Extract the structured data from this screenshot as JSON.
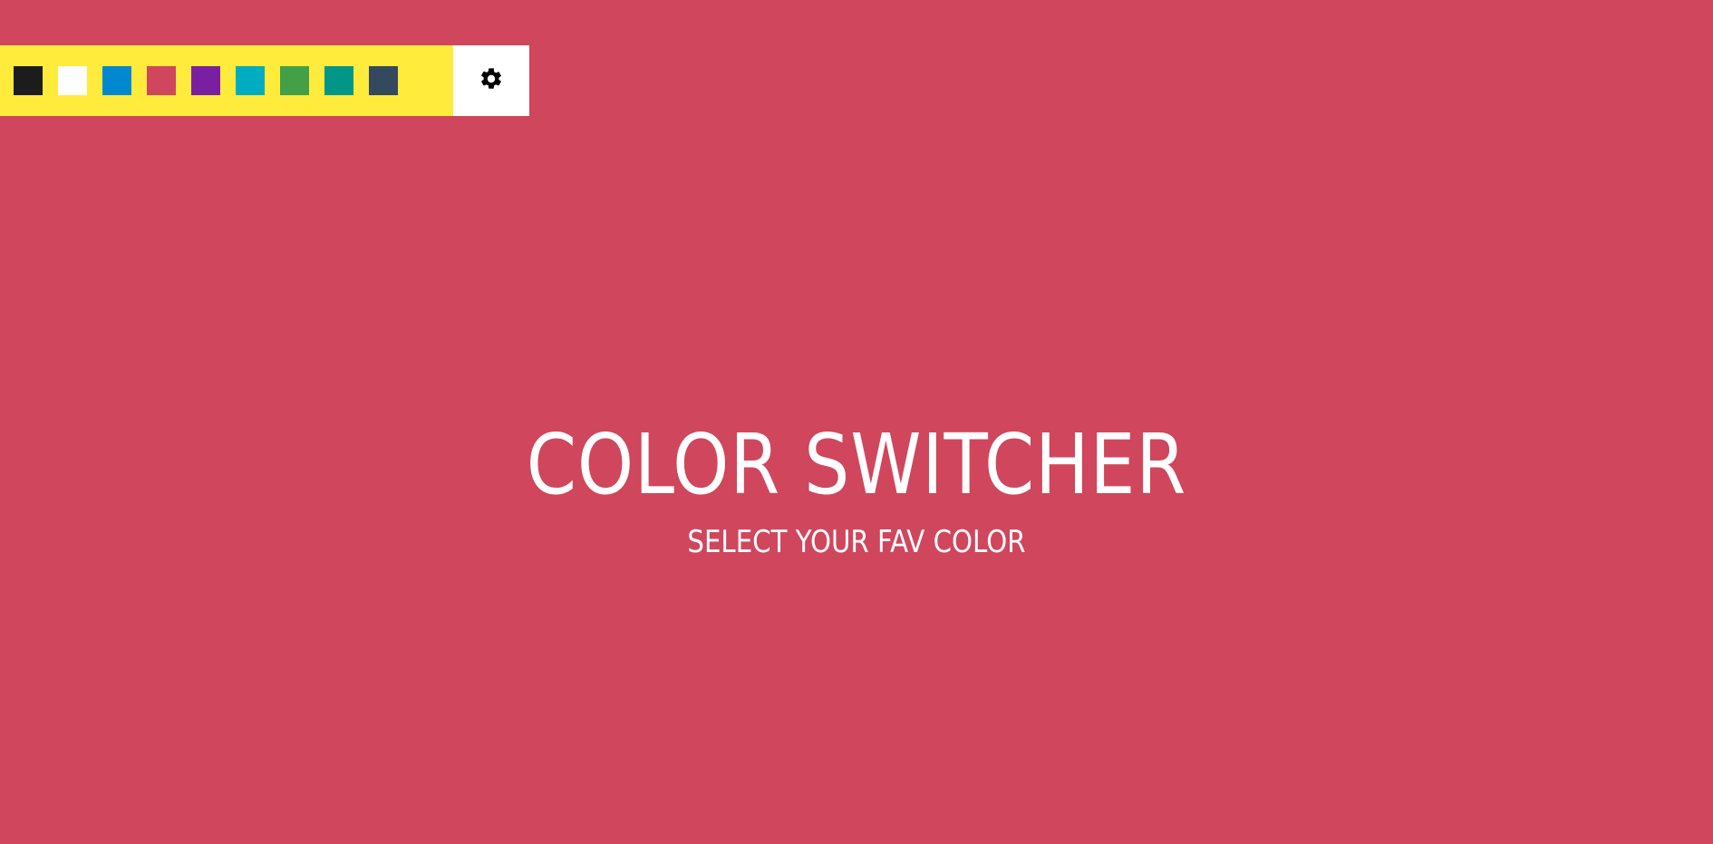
{
  "colors": {
    "background": "#d0465d",
    "palette_bg": "#ffeb3b",
    "text": "#ffffff"
  },
  "switcher": {
    "swatches": [
      {
        "name": "black",
        "color": "#1c1c1c"
      },
      {
        "name": "white",
        "color": "#ffffff"
      },
      {
        "name": "blue",
        "color": "#0288d1"
      },
      {
        "name": "red",
        "color": "#d0465d"
      },
      {
        "name": "purple",
        "color": "#7b1fa2"
      },
      {
        "name": "cyan",
        "color": "#00acc1"
      },
      {
        "name": "green",
        "color": "#43a047"
      },
      {
        "name": "teal",
        "color": "#009688"
      },
      {
        "name": "slate",
        "color": "#34495e"
      }
    ],
    "settings_icon": "gear-icon"
  },
  "hero": {
    "title": "COLOR SWITCHER",
    "subtitle": "SELECT YOUR FAV COLOR"
  }
}
